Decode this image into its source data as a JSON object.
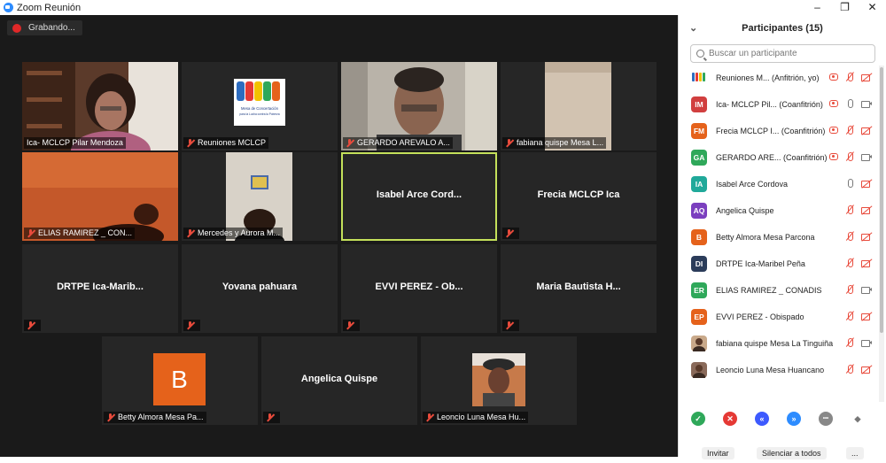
{
  "window": {
    "title": "Zoom Reunión",
    "buttons": [
      "–",
      "❐",
      "✕"
    ]
  },
  "recording": {
    "label": "Grabando..."
  },
  "gallery": {
    "tiles": [
      {
        "label": "Ica- MCLCP Pilar Mendoza",
        "center_name": "",
        "mic_muted": false,
        "video": "person-pink-room"
      },
      {
        "label": "Reuniones MCLCP",
        "center_name": "",
        "mic_muted": true,
        "video": "mclcp-logo",
        "logo_text_1": "Mesa de Concertación",
        "logo_text_2": "para la Lucha contra la Pobreza"
      },
      {
        "label": "GERARDO AREVALO A...",
        "center_name": "",
        "mic_muted": true,
        "video": "person-glasses"
      },
      {
        "label": "fabiana quispe Mesa L...",
        "center_name": "",
        "mic_muted": true,
        "video": "wall-beige"
      },
      {
        "label": "ELIAS RAMIREZ _ CON...",
        "center_name": "",
        "mic_muted": true,
        "video": "orange-room"
      },
      {
        "label": "Mercedes y Aurora  M...",
        "center_name": "",
        "mic_muted": true,
        "video": "poster-wall"
      },
      {
        "label": "",
        "center_name": "Isabel Arce Cord...",
        "mic_muted": false,
        "video": "none",
        "active": true
      },
      {
        "label": "",
        "center_name": "Frecia MCLCP Ica",
        "mic_muted": true,
        "video": "none"
      },
      {
        "label": "",
        "center_name": "DRTPE  Ica-Marib...",
        "mic_muted": true,
        "video": "none"
      },
      {
        "label": "",
        "center_name": "Yovana pahuara",
        "mic_muted": true,
        "video": "none"
      },
      {
        "label": "",
        "center_name": "EVVI PEREZ - Ob...",
        "mic_muted": true,
        "video": "none"
      },
      {
        "label": "",
        "center_name": "Maria Bautista  H...",
        "mic_muted": true,
        "video": "none"
      },
      {
        "label": "Betty Almora  Mesa Pa...",
        "center_name": "",
        "mic_muted": true,
        "video": "avatar-b",
        "avatar_letter": "B"
      },
      {
        "label": "",
        "center_name": "Angelica Quispe",
        "mic_muted": true,
        "video": "none"
      },
      {
        "label": "Leoncio Luna Mesa Hu...",
        "center_name": "",
        "mic_muted": true,
        "video": "person-cap"
      }
    ]
  },
  "participants": {
    "header": "Participantes (15)",
    "search_placeholder": "Buscar un participante",
    "list": [
      {
        "initials": "",
        "avatar_color": "#ffffff",
        "avatar_type": "logo",
        "name": "Reuniones M...  (Anfitrión, yo)",
        "rec": true,
        "mic": "muted",
        "cam": "off"
      },
      {
        "initials": "IM",
        "avatar_color": "#D13F3F",
        "name": "Ica- MCLCP Pil...  (Coanfitrión)",
        "rec": true,
        "mic": "on",
        "cam": "on"
      },
      {
        "initials": "FM",
        "avatar_color": "#E5621B",
        "name": "Frecia MCLCP I...  (Coanfitrión)",
        "rec": true,
        "mic": "muted",
        "cam": "off"
      },
      {
        "initials": "GA",
        "avatar_color": "#2FA85A",
        "name": "GERARDO ARE...  (Coanfitrión)",
        "rec": true,
        "mic": "muted",
        "cam": "on"
      },
      {
        "initials": "IA",
        "avatar_color": "#20A99A",
        "name": "Isabel Arce Cordova",
        "rec": false,
        "mic": "on",
        "cam": "off"
      },
      {
        "initials": "AQ",
        "avatar_color": "#7B3FBF",
        "name": "Angelica Quispe",
        "rec": false,
        "mic": "muted",
        "cam": "off"
      },
      {
        "initials": "B",
        "avatar_color": "#E5621B",
        "name": "Betty Almora  Mesa Parcona",
        "rec": false,
        "mic": "muted",
        "cam": "off"
      },
      {
        "initials": "DI",
        "avatar_color": "#2B3C5A",
        "name": "DRTPE  Ica-Maribel Peña",
        "rec": false,
        "mic": "muted",
        "cam": "off"
      },
      {
        "initials": "ER",
        "avatar_color": "#2FA85A",
        "name": "ELIAS RAMIREZ _ CONADIS",
        "rec": false,
        "mic": "muted",
        "cam": "on"
      },
      {
        "initials": "EP",
        "avatar_color": "#E5621B",
        "name": "EVVI PEREZ - Obispado",
        "rec": false,
        "mic": "muted",
        "cam": "off"
      },
      {
        "initials": "",
        "avatar_color": "#c9a98a",
        "avatar_type": "photo",
        "name": "fabiana quispe Mesa La Tinguiña",
        "rec": false,
        "mic": "muted",
        "cam": "on"
      },
      {
        "initials": "",
        "avatar_color": "#8a6a5a",
        "avatar_type": "photo",
        "name": "Leoncio Luna Mesa Huancano",
        "rec": false,
        "mic": "muted",
        "cam": "off"
      }
    ]
  },
  "reactions": [
    {
      "name": "yes",
      "color": "#2FA85A",
      "glyph": "✓"
    },
    {
      "name": "no",
      "color": "#E53935",
      "glyph": "✕"
    },
    {
      "name": "go-slower",
      "color": "#3D5AFE",
      "glyph": "«"
    },
    {
      "name": "go-faster",
      "color": "#2D8CFF",
      "glyph": "»"
    },
    {
      "name": "more",
      "color": "#888888",
      "glyph": "•••"
    },
    {
      "name": "clear",
      "color": "#777777",
      "glyph": "◆"
    }
  ],
  "footer": {
    "invite": "Invitar",
    "mute_all": "Silenciar a todos",
    "more": "..."
  }
}
